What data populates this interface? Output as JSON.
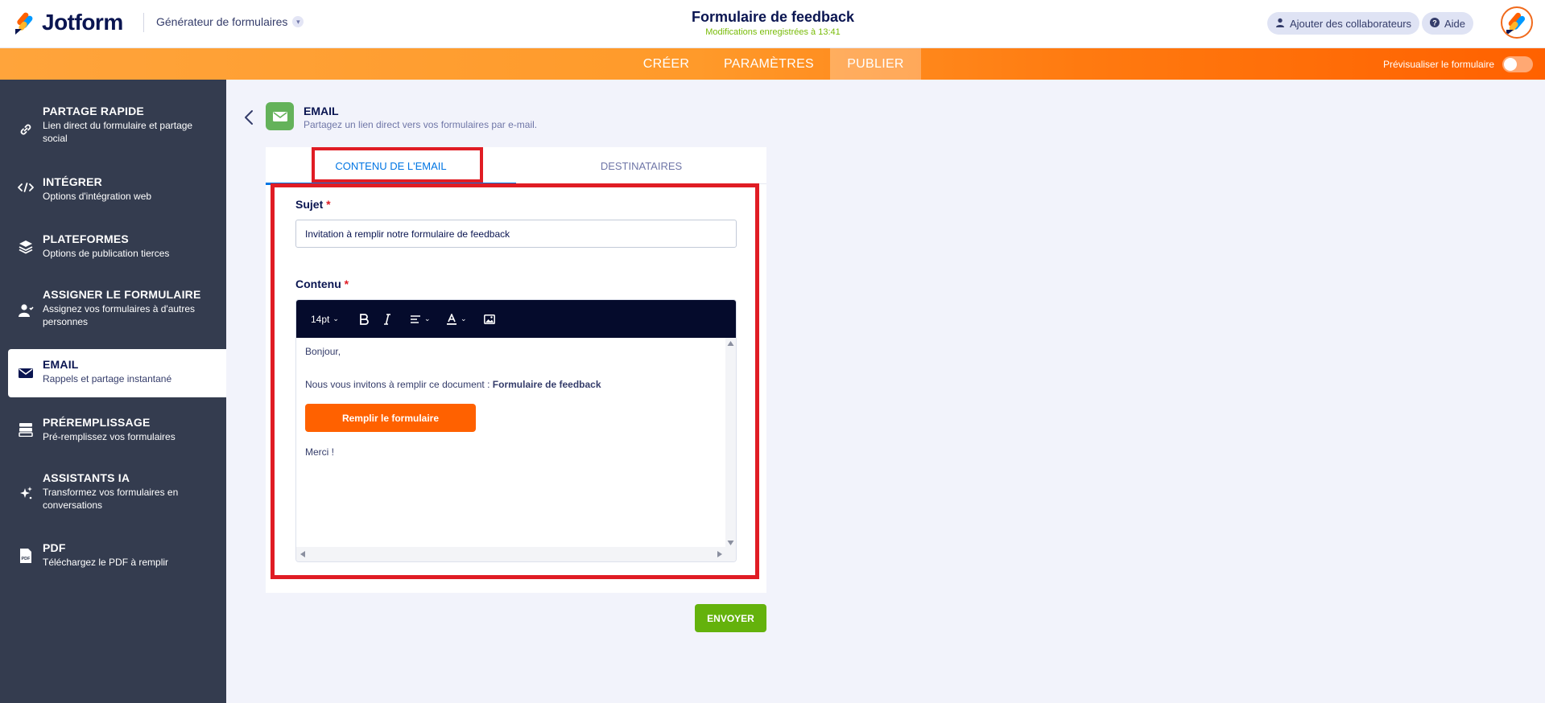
{
  "header": {
    "brand": "Jotform",
    "builder_label": "Générateur de formulaires",
    "form_title": "Formulaire de feedback",
    "save_status": "Modifications enregistrées à 13:41",
    "collaborators_label": "Ajouter des collaborateurs",
    "help_label": "Aide"
  },
  "nav": {
    "tabs": [
      {
        "label": "CRÉER"
      },
      {
        "label": "PARAMÈTRES"
      },
      {
        "label": "PUBLIER"
      }
    ],
    "active_tab": "PUBLIER",
    "preview_label": "Prévisualiser le formulaire",
    "preview_on": false
  },
  "sidebar": {
    "items": [
      {
        "title": "PARTAGE RAPIDE",
        "desc": "Lien direct du formulaire et partage social",
        "icon": "link-icon"
      },
      {
        "title": "INTÉGRER",
        "desc": "Options d'intégration web",
        "icon": "code-icon"
      },
      {
        "title": "PLATEFORMES",
        "desc": "Options de publication tierces",
        "icon": "layers-icon"
      },
      {
        "title": "ASSIGNER LE FORMULAIRE",
        "desc": "Assignez vos formulaires à d'autres personnes",
        "icon": "assign-user-icon"
      },
      {
        "title": "EMAIL",
        "desc": "Rappels et partage instantané",
        "icon": "envelope-icon",
        "active": true
      },
      {
        "title": "PRÉREMPLISSAGE",
        "desc": "Pré-remplissez vos formulaires",
        "icon": "prefill-icon"
      },
      {
        "title": "ASSISTANTS IA",
        "desc": "Transformez vos formulaires en conversations",
        "icon": "sparkle-icon"
      },
      {
        "title": "PDF",
        "desc": "Téléchargez le PDF à remplir",
        "icon": "pdf-icon"
      }
    ]
  },
  "main": {
    "section_title": "EMAIL",
    "section_subtitle": "Partagez un lien direct vers vos formulaires par e-mail.",
    "tabs": [
      {
        "label": "CONTENU DE L'EMAIL",
        "active": true
      },
      {
        "label": "DESTINATAIRES",
        "active": false
      }
    ],
    "subject_label": "Sujet",
    "subject_value": "Invitation à remplir notre formulaire de feedback",
    "content_label": "Contenu",
    "required_mark": "*",
    "editor": {
      "font_size": "14pt",
      "greeting": "Bonjour,",
      "body_prefix": "Nous vous invitons à remplir ce document : ",
      "body_form_name": "Formulaire de feedback",
      "button_label": "Remplir le formulaire",
      "closing": "Merci !"
    },
    "send_label": "ENVOYER"
  },
  "colors": {
    "accent_orange": "#ff6100",
    "nav_gradient_start": "#ffa43b",
    "active_tab_blue": "#0075e3",
    "highlight_red": "#e01c24",
    "send_green": "#64b20c",
    "sidebar_bg": "#343c4f",
    "toolbar_bg": "#050b2c"
  }
}
